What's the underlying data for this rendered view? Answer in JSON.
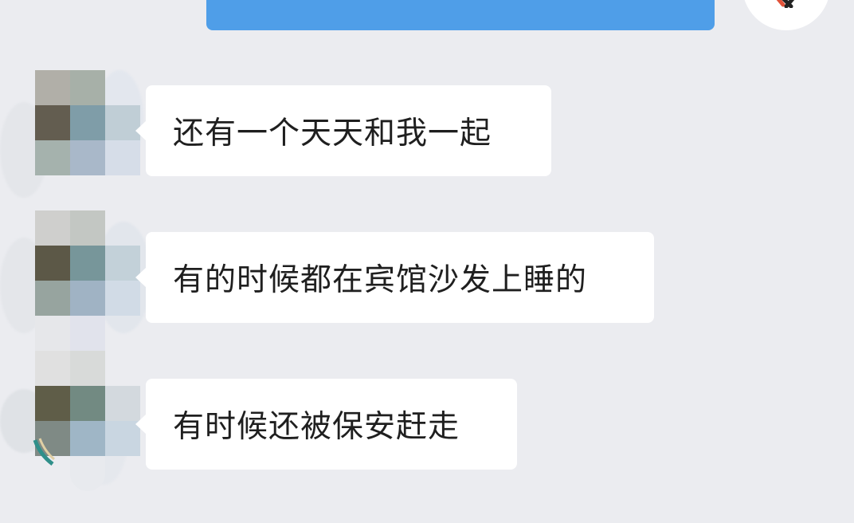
{
  "chat": {
    "messages": [
      {
        "direction": "incoming",
        "text": "还有一个天天和我一起"
      },
      {
        "direction": "incoming",
        "text": "有的时候都在宾馆沙发上睡的"
      },
      {
        "direction": "incoming",
        "text": "有时候还被保安赶走"
      }
    ]
  },
  "colors": {
    "background": "#ebecf0",
    "incoming_bubble": "#ffffff",
    "outgoing_bubble": "#4f9ee8",
    "text": "#1f1f1f"
  },
  "icons": {
    "self_avatar": "self-avatar",
    "contact_avatar": "pixelated-avatar"
  }
}
